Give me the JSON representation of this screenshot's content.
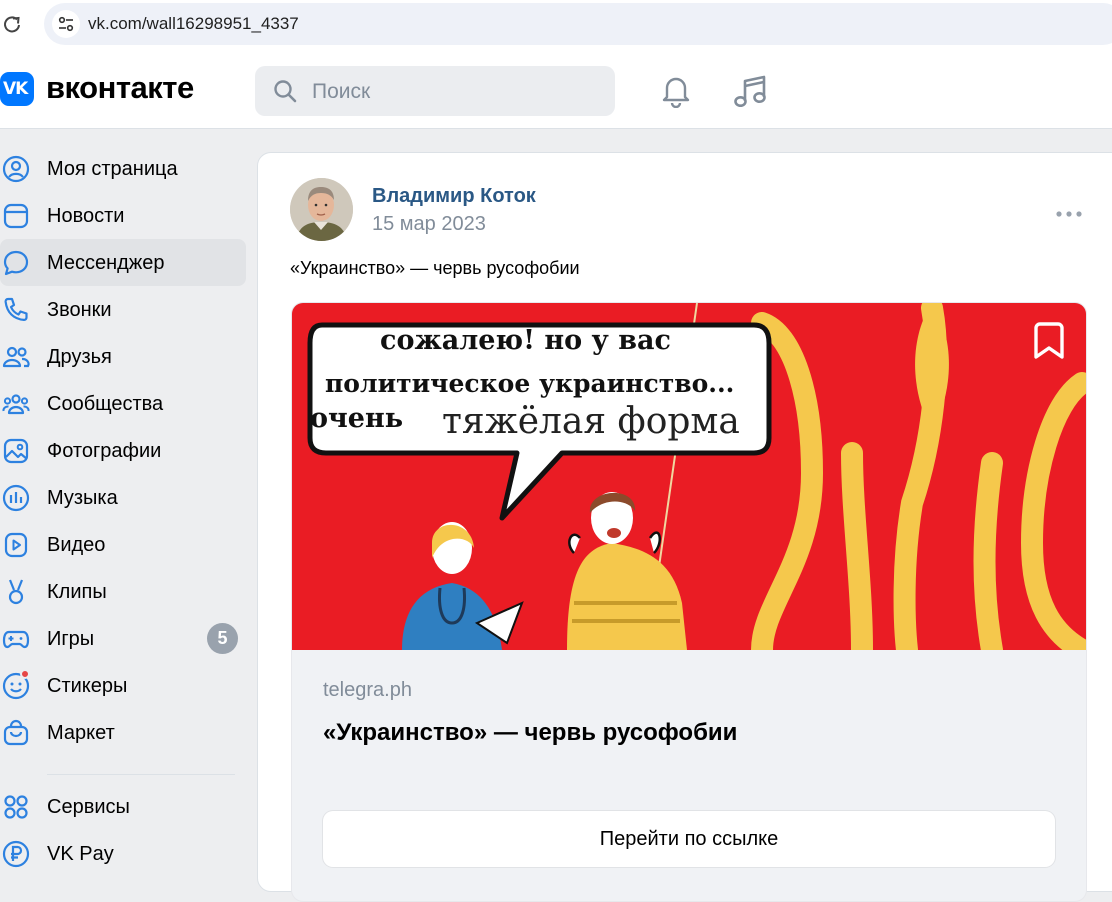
{
  "browser": {
    "url": "vk.com/wall16298951_4337"
  },
  "header": {
    "logo_text": "VK",
    "brand": "вконтакте",
    "search_placeholder": "Поиск"
  },
  "sidebar": {
    "items": [
      {
        "label": "Моя страница",
        "icon": "user-circle-icon"
      },
      {
        "label": "Новости",
        "icon": "news-icon"
      },
      {
        "label": "Мессенджер",
        "icon": "message-bubble-icon",
        "active": true
      },
      {
        "label": "Звонки",
        "icon": "phone-icon"
      },
      {
        "label": "Друзья",
        "icon": "friends-icon"
      },
      {
        "label": "Сообщества",
        "icon": "communities-icon"
      },
      {
        "label": "Фотографии",
        "icon": "photo-icon"
      },
      {
        "label": "Музыка",
        "icon": "music-bars-icon"
      },
      {
        "label": "Видео",
        "icon": "video-icon"
      },
      {
        "label": "Клипы",
        "icon": "clips-icon"
      },
      {
        "label": "Игры",
        "icon": "gamepad-icon",
        "badge": "5"
      },
      {
        "label": "Стикеры",
        "icon": "sticker-icon"
      },
      {
        "label": "Маркет",
        "icon": "market-bag-icon"
      }
    ],
    "bottom_items": [
      {
        "label": "Сервисы",
        "icon": "services-grid-icon"
      },
      {
        "label": "VK Pay",
        "icon": "ruble-icon"
      }
    ]
  },
  "post": {
    "author": "Владимир Коток",
    "date": "15 мар 2023",
    "text": "«Украинство» — червь русофобии",
    "image_caption": {
      "line1": "сожалею! но у вас",
      "line2": "политическое украинство...",
      "line3a": "очень",
      "line3b": "тяжёлая форма"
    },
    "snippet": {
      "domain": "telegra.ph",
      "title": "«Украинство» — червь русофобии",
      "button": "Перейти по ссылке"
    }
  },
  "colors": {
    "accent": "#0077ff",
    "author_link": "#2a5885",
    "image_bg": "#ea1c24",
    "trident": "#f5c84c",
    "page_bg": "#edeef0"
  }
}
